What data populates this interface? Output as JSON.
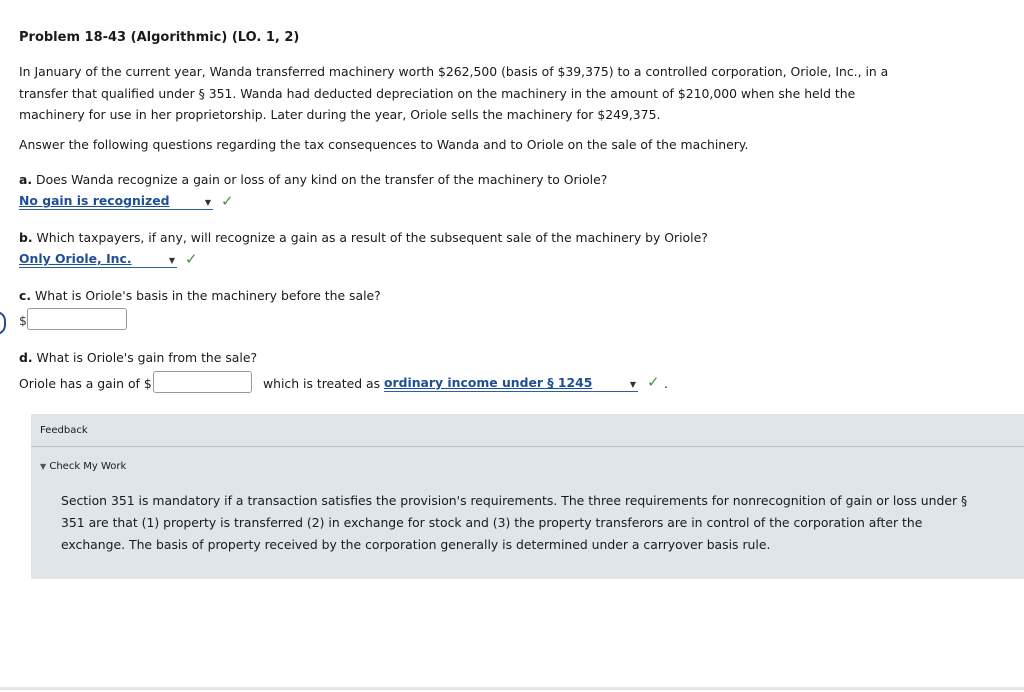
{
  "problem": {
    "title": "Problem 18-43 (Algorithmic) (LO. 1, 2)",
    "intro": "In January of the current year, Wanda transferred machinery worth $262,500 (basis of $39,375) to a controlled corporation, Oriole, Inc., in a transfer that qualified under § 351. Wanda had deducted depreciation on the machinery in the amount of $210,000 when she held the machinery for use in her proprietorship. Later during the year, Oriole sells the machinery for $249,375.",
    "instructions": "Answer the following questions regarding the tax consequences to Wanda and to Oriole on the sale of the machinery."
  },
  "questions": {
    "a": {
      "letter": "a.",
      "text": "Does Wanda recognize a gain or loss of any kind on the transfer of the machinery to Oriole?",
      "selected": "No gain is recognized"
    },
    "b": {
      "letter": "b.",
      "text": "Which taxpayers, if any, will recognize a gain as a result of the subsequent sale of the machinery by Oriole?",
      "selected": "Only Oriole, Inc."
    },
    "c": {
      "letter": "c.",
      "text": "What is Oriole's basis in the machinery before the sale?",
      "currency": "$",
      "value": ""
    },
    "d": {
      "letter": "d.",
      "text": "What is Oriole's gain from the sale?",
      "prefix": "Oriole has a gain of $",
      "value": "",
      "middle": "which is treated as",
      "selected": "ordinary income under § 1245",
      "suffix": "."
    }
  },
  "feedback": {
    "title": "Feedback",
    "check_label": "Check My Work",
    "body": "Section 351 is mandatory if a transaction satisfies the provision's requirements. The three requirements for nonrecognition of gain or loss under § 351 are that (1) property is transferred (2) in exchange for stock and (3) the property transferors are in control of the corporation after the exchange. The basis of property received by the corporation generally is determined under a carryover basis rule."
  },
  "icons": {
    "check": "check-icon",
    "dropdown": "chevron-down-icon",
    "triangle": "triangle-down-icon"
  },
  "colors": {
    "accent": "#1f4e95",
    "check": "#3c9a3c",
    "feedback_bg": "#dfe5e8"
  }
}
